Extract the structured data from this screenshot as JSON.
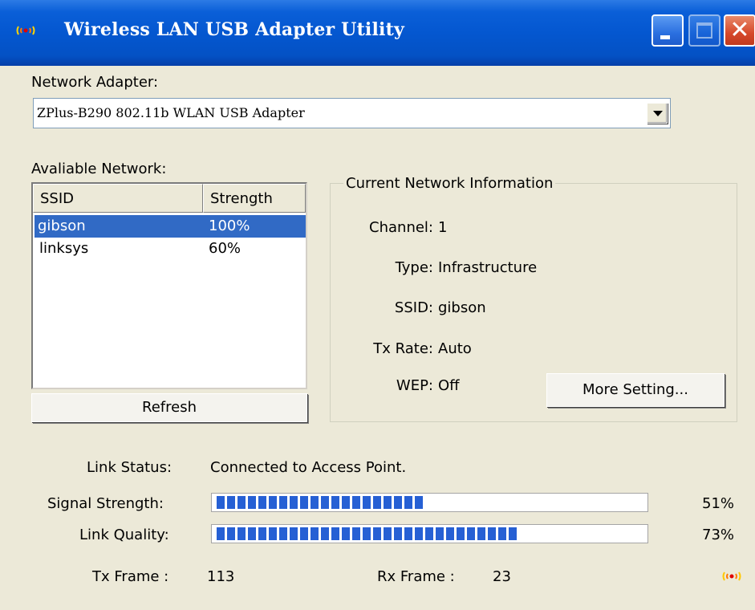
{
  "window": {
    "title": "Wireless LAN USB Adapter Utility",
    "app_icon": "wireless-antenna-icon",
    "controls": [
      "minimize",
      "maximize",
      "close"
    ]
  },
  "adapter": {
    "label": "Network Adapter:",
    "selected": "ZPlus-B290 802.11b WLAN USB Adapter"
  },
  "available": {
    "label": "Avaliable Network:",
    "columns": {
      "ssid": "SSID",
      "strength": "Strength"
    },
    "rows": [
      {
        "ssid": "gibson",
        "strength": "100%",
        "selected": true
      },
      {
        "ssid": "linksys",
        "strength": "60%",
        "selected": false
      }
    ],
    "refresh_label": "Refresh"
  },
  "current": {
    "legend": "Current Network Information",
    "channel_label": "Channel:",
    "channel": "1",
    "type_label": "Type:",
    "type": "Infrastructure",
    "ssid_label": "SSID:",
    "ssid": "gibson",
    "txrate_label": "Tx Rate:",
    "txrate": "Auto",
    "wep_label": "WEP:",
    "wep": "Off",
    "more_label": "More Setting..."
  },
  "status": {
    "link_label": "Link Status:",
    "link": "Connected to Access Point.",
    "signal_label": "Signal Strength:",
    "signal_pct": "51%",
    "signal_value": 51,
    "quality_label": "Link Quality:",
    "quality_pct": "73%",
    "quality_value": 73,
    "tx_label": "Tx Frame :",
    "tx": "113",
    "rx_label": "Rx Frame :",
    "rx": "23"
  },
  "colors": {
    "selection": "#316ac5",
    "progress": "#2660d4",
    "titlebar": "#0457d0"
  }
}
